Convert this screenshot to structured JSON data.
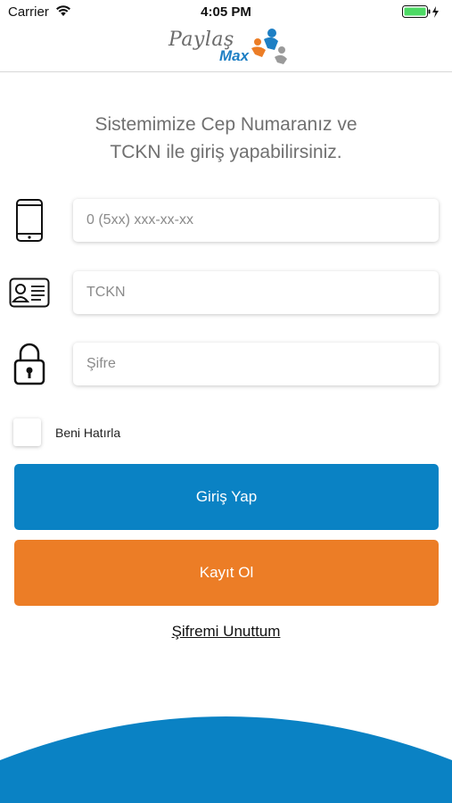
{
  "status_bar": {
    "carrier": "Carrier",
    "time": "4:05 PM"
  },
  "logo": {
    "line1": "Paylaş",
    "line2": "Max"
  },
  "heading": {
    "line1": "Sistemimize Cep Numaranız ve",
    "line2": "TCKN ile giriş yapabilirsiniz."
  },
  "form": {
    "phone": {
      "placeholder": "0 (5xx) xxx-xx-xx",
      "value": "",
      "icon": "phone-icon"
    },
    "tckn": {
      "placeholder": "TCKN",
      "value": "",
      "icon": "id-card-icon"
    },
    "password": {
      "placeholder": "Şifre",
      "value": "",
      "icon": "lock-icon"
    },
    "remember_label": "Beni Hatırla",
    "remember_checked": false
  },
  "buttons": {
    "login": "Giriş Yap",
    "register": "Kayıt Ol",
    "forgot": "Şifremi Unuttum"
  },
  "colors": {
    "primary": "#0a82c4",
    "accent": "#ec7d26",
    "battery": "#4cd964"
  }
}
